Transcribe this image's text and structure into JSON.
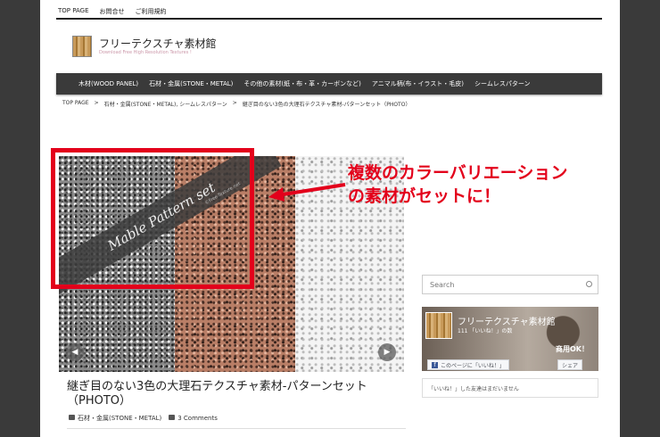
{
  "topnav": {
    "items": [
      "TOP PAGE",
      "お問合せ",
      "ご利用規約"
    ]
  },
  "site": {
    "title": "フリーテクスチャ素材館",
    "subtitle": "Download Free High Resolution Textures !"
  },
  "mainnav": {
    "items": [
      "木材(WOOD PANEL)",
      "石材・金属(STONE・METAL)",
      "その他の素材(紙・布・革・カーボンなど)",
      "アニマル柄(布・イラスト・毛皮)",
      "シームレスパターン"
    ]
  },
  "breadcrumb": {
    "home": "TOP PAGE",
    "sep": ">",
    "category": "石材・金属(STONE・METAL), シームレスパターン",
    "current": "継ぎ目のない3色の大理石テクスチャ素材-パターンセット（PHOTO）"
  },
  "slide": {
    "band_text": "Mable Pattern set",
    "band_sub": "©Free-Texture.net",
    "prev": "◀",
    "next": "▶"
  },
  "annotation": {
    "line1": "複数のカラーバリエーション",
    "line2": "の素材がセットに！"
  },
  "post": {
    "title": "継ぎ目のない3色の大理石テクスチャ素材-パターンセット（PHOTO）",
    "category": "石材・金属(STONE・METAL)",
    "comments": "3 Comments"
  },
  "sidebar": {
    "search_placeholder": "Search",
    "fb": {
      "name": "フリーテクスチャ素材館",
      "likes": "111 「いいね！」の数",
      "stamp": "商用OK！",
      "like_button": "このページに「いいね！」",
      "share_button": "シェア",
      "friends_text": "「いいね！」した友達はまだいません"
    }
  },
  "colors": {
    "accent_red": "#e3001b",
    "nav_bg": "#3a3a3a"
  }
}
